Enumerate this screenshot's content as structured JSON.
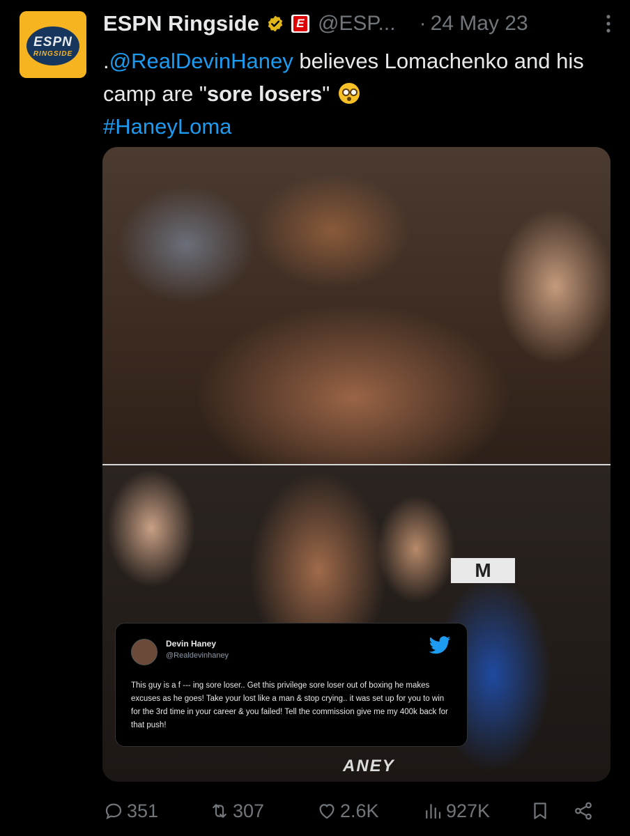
{
  "account": {
    "name": "ESPN Ringside",
    "handle": "@ESP...",
    "date": "24 May 23",
    "separator": "·",
    "avatar_text_top": "ESPN",
    "avatar_text_bottom": "RINGSIDE",
    "affiliate_badge_letter": "E"
  },
  "tweet": {
    "prefix": ".",
    "mention": "@RealDevinHaney",
    "text_part1": " believes Lomachenko and his camp are \"",
    "bold": "sore losers",
    "text_part2": "\" ",
    "emoji": "flushed-face",
    "hashtag": "#HaneyLoma"
  },
  "media": {
    "sign_text": "M",
    "jersey_text": "ANEY",
    "embedded_tweet": {
      "name": "Devin Haney",
      "handle": "@Realdevinhaney",
      "body": "This guy is a f --- ing sore loser.. Get this privilege sore loser out of boxing he makes excuses as he goes! Take your lost like a man & stop crying.. it was set up for you to win for the 3rd time in your career & you failed! Tell the commission give me my 400k back for that push!"
    }
  },
  "actions": {
    "replies": "351",
    "reposts": "307",
    "likes": "2.6K",
    "views": "927K"
  },
  "colors": {
    "background": "#000000",
    "link": "#1d9bf0",
    "muted": "#71767b",
    "verified_gold": "#e2b719"
  }
}
